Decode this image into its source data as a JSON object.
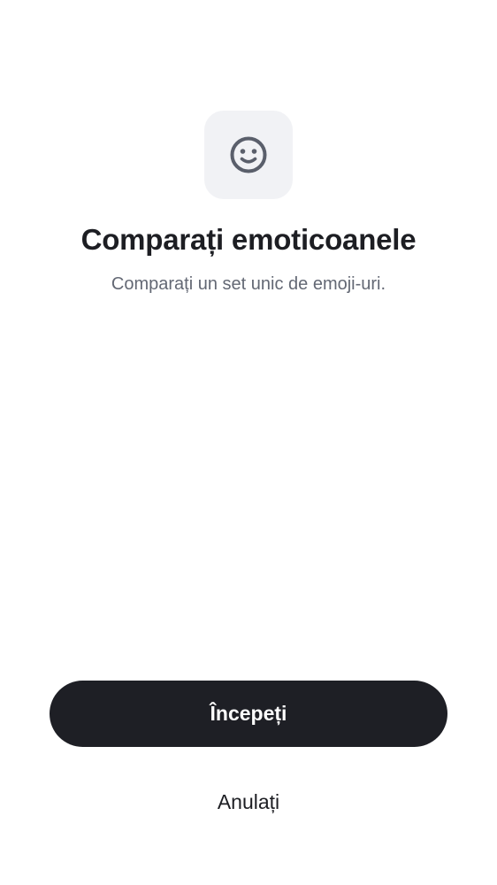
{
  "header": {
    "icon": "smiley-face-icon",
    "title": "Comparați emoticoanele",
    "subtitle": "Comparați un set unic de emoji-uri."
  },
  "actions": {
    "start_label": "Începeți",
    "cancel_label": "Anulați"
  },
  "colors": {
    "primary_button_bg": "#1e1f25",
    "icon_tile_bg": "#f1f2f5",
    "icon_color": "#5a5f6b",
    "title_color": "#1d1e23",
    "subtitle_color": "#636874"
  }
}
